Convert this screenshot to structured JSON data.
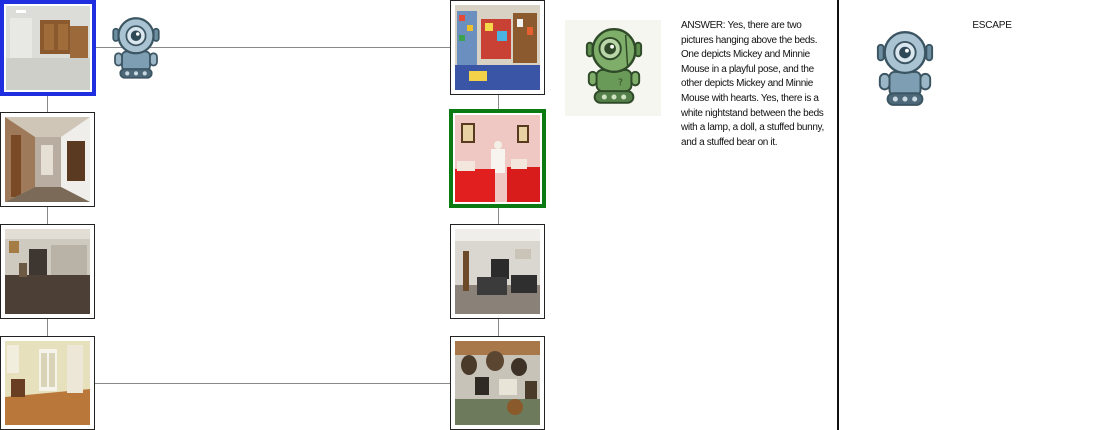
{
  "answer": {
    "text": "ANSWER: Yes, there are two pictures hanging above the beds. One depicts Mickey and Minnie Mouse in a playful pose, and the other depicts Mickey and Minnie Mouse with hearts.   Yes, there is a white nightstand between the beds with a lamp, a doll, a stuffed bunny, and a stuffed bear on it."
  },
  "escape": {
    "label": "ESCAPE"
  },
  "colors": {
    "current_node_border": "#1f2fe0",
    "target_node_border": "#0b7a12",
    "robot_blue": "#8fb0c4",
    "robot_green": "#6a9a58"
  },
  "icons": {
    "navigator": "robot-icon",
    "agent": "green-robot-icon",
    "escape": "robot-icon"
  },
  "nodes": [
    {
      "scene": "white basement room with wooden cabinets",
      "state": "current"
    },
    {
      "scene": "hallway with wooden doors",
      "state": "default"
    },
    {
      "scene": "dark room with fireplace",
      "state": "default"
    },
    {
      "scene": "room with hardwood floor and French doors",
      "state": "default"
    },
    {
      "scene": "children's playroom with toys",
      "state": "default"
    },
    {
      "scene": "bedroom with two red beds",
      "state": "target"
    },
    {
      "scene": "living room with sofas and TV",
      "state": "default"
    },
    {
      "scene": "room with mounted animal trophies",
      "state": "default"
    }
  ]
}
